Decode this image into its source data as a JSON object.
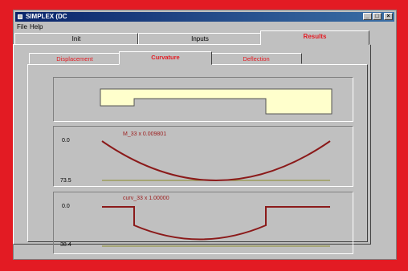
{
  "window": {
    "title": "SIMPLEX (DC"
  },
  "menu": {
    "file": "File",
    "help": "Help"
  },
  "main_tabs": [
    {
      "label": "Init"
    },
    {
      "label": "Inputs"
    },
    {
      "label": "Results"
    }
  ],
  "sub_tabs": [
    {
      "label": "Displacement"
    },
    {
      "label": "Curvature"
    },
    {
      "label": "Deflection"
    }
  ],
  "plots": {
    "profile": {},
    "moment": {
      "caption": "M_33 x 0.009801",
      "y_top": "0.0",
      "y_bottom": "73.5"
    },
    "curvature": {
      "caption": "curv_33 x 1.00000",
      "y_top": "0.0",
      "y_bottom": "38.4"
    }
  },
  "colors": {
    "accent": "#e31b23",
    "curve": "#8b1a1a",
    "baseline": "#8a8a2a",
    "beam": "#ffffcc"
  }
}
